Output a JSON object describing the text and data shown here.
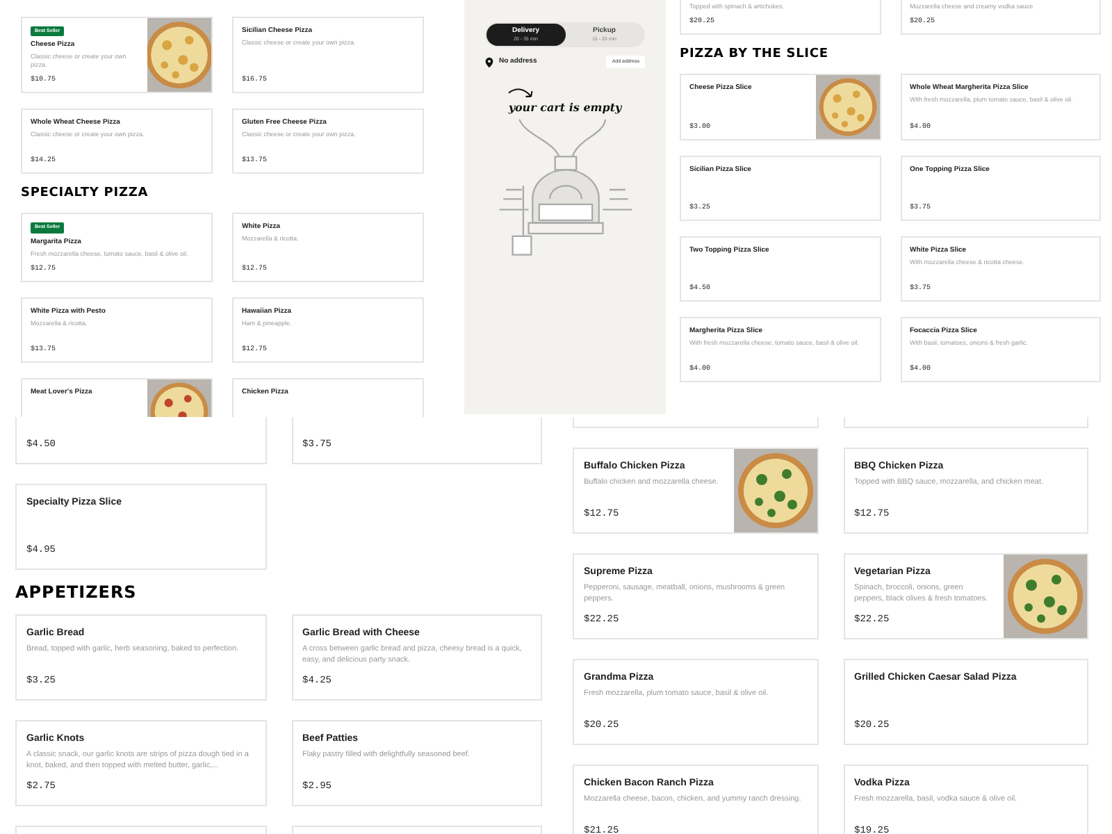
{
  "panels": [
    {
      "kind": "menu_small",
      "sections": [
        {
          "cards": [
            {
              "kind": "item",
              "badge": "Best Seller",
              "title": "Cheese Pizza",
              "description": "Classic cheese or create your own pizza.",
              "price": "$10.75",
              "picture": true
            },
            {
              "kind": "item",
              "title": "Sicilian Cheese Pizza",
              "description": "Classic cheese or create your own pizza.",
              "price": "$16.75"
            },
            {
              "kind": "item",
              "title": "Whole Wheat Cheese Pizza",
              "description": "Classic cheese or create your own pizza.",
              "price": "$14.25"
            },
            {
              "kind": "item",
              "title": "Gluten Free Cheese Pizza",
              "description": "Classic cheese or create your own pizza.",
              "price": "$13.75"
            }
          ]
        },
        {
          "heading": "SPECIALTY PIZZA",
          "cards": [
            {
              "kind": "item",
              "badge": "Best Seller",
              "title": "Margarita Pizza",
              "description": "Fresh mozzarella cheese, tomato sauce, basil & olive oil.",
              "price": "$12.75"
            },
            {
              "kind": "item",
              "title": "White Pizza",
              "description": "Mozzarella & ricotta.",
              "price": "$12.75"
            },
            {
              "kind": "item",
              "title": "White Pizza with Pesto",
              "description": "Mozzarella & ricotta.",
              "price": "$13.75"
            },
            {
              "kind": "item",
              "title": "Hawaiian Pizza",
              "description": "Ham & pineapple.",
              "price": "$12.75"
            },
            {
              "kind": "item",
              "title": "Meat Lover's Pizza",
              "picture": true
            },
            {
              "kind": "item",
              "title": "Chicken Pizza"
            }
          ]
        }
      ]
    },
    {
      "kind": "cart",
      "modes": [
        {
          "label": "Delivery",
          "time": "20 - 35 min",
          "selected": true
        },
        {
          "label": "Pickup",
          "time": "15 - 20 min",
          "selected": false
        }
      ],
      "address": "No address",
      "address_button": "Add address",
      "empty_text": "your cart is empty"
    },
    {
      "kind": "menu_small",
      "sections": [
        {
          "cards": [
            {
              "kind": "cut_top",
              "description": "Topped with spinach & artichokes.",
              "price": "$20.25"
            },
            {
              "kind": "cut_top",
              "description": "Mozzarella cheese and creamy vodka sauce",
              "price": "$20.25"
            }
          ]
        },
        {
          "heading": "PIZZA BY THE SLICE",
          "cards": [
            {
              "kind": "item",
              "title": "Cheese Pizza Slice",
              "price": "$3.00",
              "picture": true
            },
            {
              "kind": "item",
              "title": "Whole Wheat Margherita Pizza Slice",
              "description": "With fresh mozzarella, plum tomato sauce, basil & olive oil.",
              "price": "$4.00"
            },
            {
              "kind": "item",
              "title": "Sicilian Pizza Slice",
              "price": "$3.25"
            },
            {
              "kind": "item",
              "title": "One Topping Pizza Slice",
              "price": "$3.75"
            },
            {
              "kind": "item",
              "title": "Two Topping Pizza Slice",
              "price": "$4.50"
            },
            {
              "kind": "item",
              "title": "White Pizza Slice",
              "description": "With mozzarella cheese & ricotta cheese.",
              "price": "$3.75"
            },
            {
              "kind": "item",
              "title": "Margherita Pizza Slice",
              "description": "With fresh mozzarella cheese, tomato sauce, basil & olive oil.",
              "price": "$4.00"
            },
            {
              "kind": "item",
              "title": "Focaccia Pizza Slice",
              "description": "With basil, tomatoes, onions & fresh garlic.",
              "price": "$4.00"
            }
          ]
        }
      ]
    },
    {
      "kind": "menu_large",
      "sections": [
        {
          "cards": [
            {
              "kind": "cut_top",
              "price": "$4.50"
            },
            {
              "kind": "cut_top",
              "price": "$3.75"
            },
            {
              "kind": "item",
              "title": "Specialty Pizza Slice",
              "price": "$4.95"
            }
          ]
        },
        {
          "heading": "APPETIZERS",
          "cards": [
            {
              "kind": "item",
              "title": "Garlic Bread",
              "description": "Bread, topped with garlic, herb seasoning, baked to perfection.",
              "price": "$3.25"
            },
            {
              "kind": "item",
              "title": "Garlic Bread with Cheese",
              "description": "A cross between garlic bread and pizza, cheesy bread is a quick, easy, and delicious party snack.",
              "price": "$4.25"
            },
            {
              "kind": "item",
              "title": "Garlic Knots",
              "description": "A classic snack, our garlic knots are strips of pizza dough tied in a knot, baked, and then topped with melted butter, garlic,...",
              "price": "$2.75"
            },
            {
              "kind": "item",
              "title": "Beef Patties",
              "description": "Flaky pastry filled with delightfully seasoned beef.",
              "price": "$2.95"
            },
            {
              "kind": "edge"
            },
            {
              "kind": "edge"
            }
          ]
        }
      ]
    },
    {
      "kind": "menu_large",
      "sections": [
        {
          "cards": [
            {
              "kind": "edge_top"
            },
            {
              "kind": "edge_top"
            },
            {
              "kind": "item",
              "title": "Buffalo Chicken Pizza",
              "description": "Buffalo chicken and mozzarella cheese.",
              "price": "$12.75",
              "picture": true
            },
            {
              "kind": "item",
              "title": "BBQ Chicken Pizza",
              "description": "Topped with BBQ sauce, mozzarella, and chicken meat.",
              "price": "$12.75"
            },
            {
              "kind": "item",
              "title": "Supreme Pizza",
              "description": "Pepperoni, sausage, meatball, onions, mushrooms & green peppers.",
              "price": "$22.25"
            },
            {
              "kind": "item",
              "title": "Vegetarian Pizza",
              "description": "Spinach, broccoli, onions, green peppers, black olives & fresh tomatoes.",
              "price": "$22.25",
              "picture": true
            },
            {
              "kind": "item",
              "title": "Grandma Pizza",
              "description": "Fresh mozzarella, plum tomato sauce, basil & olive oil.",
              "price": "$20.25"
            },
            {
              "kind": "item",
              "title": "Grilled Chicken Caesar Salad Pizza",
              "price": "$20.25"
            },
            {
              "kind": "item",
              "title": "Chicken Bacon Ranch Pizza",
              "description": "Mozzarella cheese, bacon, chicken, and yummy ranch dressing.",
              "price": "$21.25"
            },
            {
              "kind": "item",
              "title": "Vodka Pizza",
              "description": "Fresh mozzarella, basil, vodka sauce & olive oil.",
              "price": "$19.25"
            }
          ]
        }
      ]
    }
  ]
}
